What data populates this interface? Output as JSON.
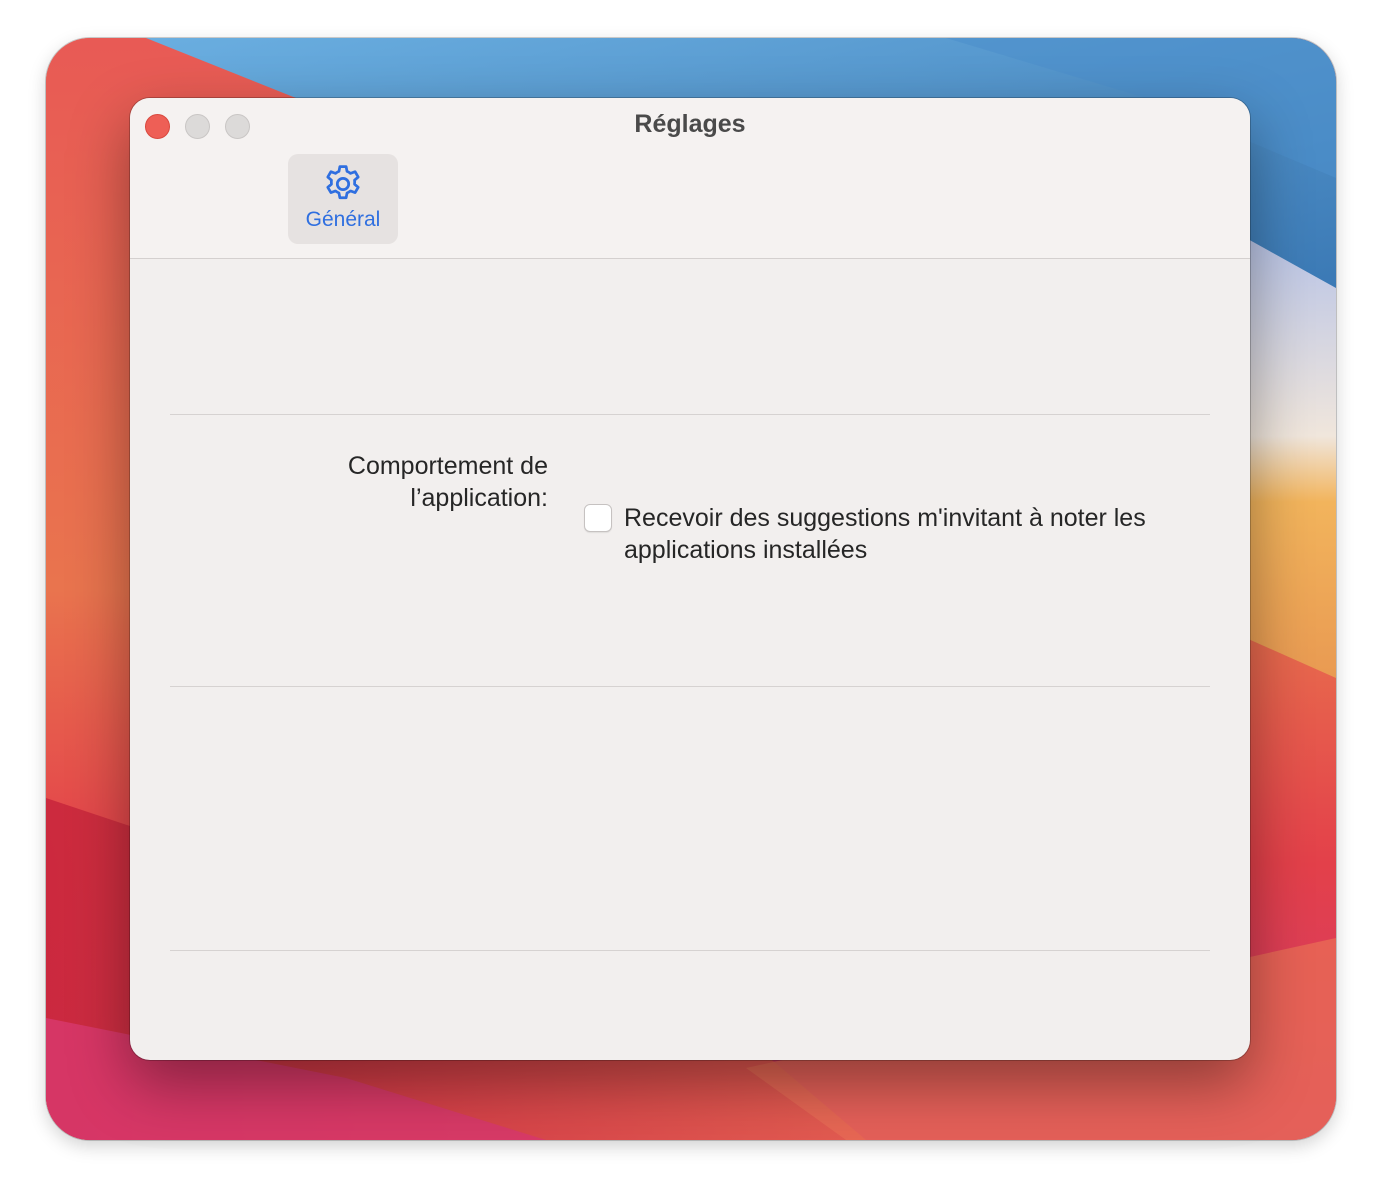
{
  "window": {
    "title": "Réglages"
  },
  "toolbar": {
    "tabs": [
      {
        "label": "Général",
        "icon": "gear-icon",
        "selected": true
      }
    ],
    "accent_color": "#2f6fe0"
  },
  "settings": {
    "app_behavior": {
      "label": "Comportement de l’application:",
      "checkbox_label": "Recevoir des suggestions m'invitant à noter les applications installées",
      "checked": false
    }
  },
  "colors": {
    "close_button": "#ee5f56",
    "window_background": "#f2efee"
  }
}
